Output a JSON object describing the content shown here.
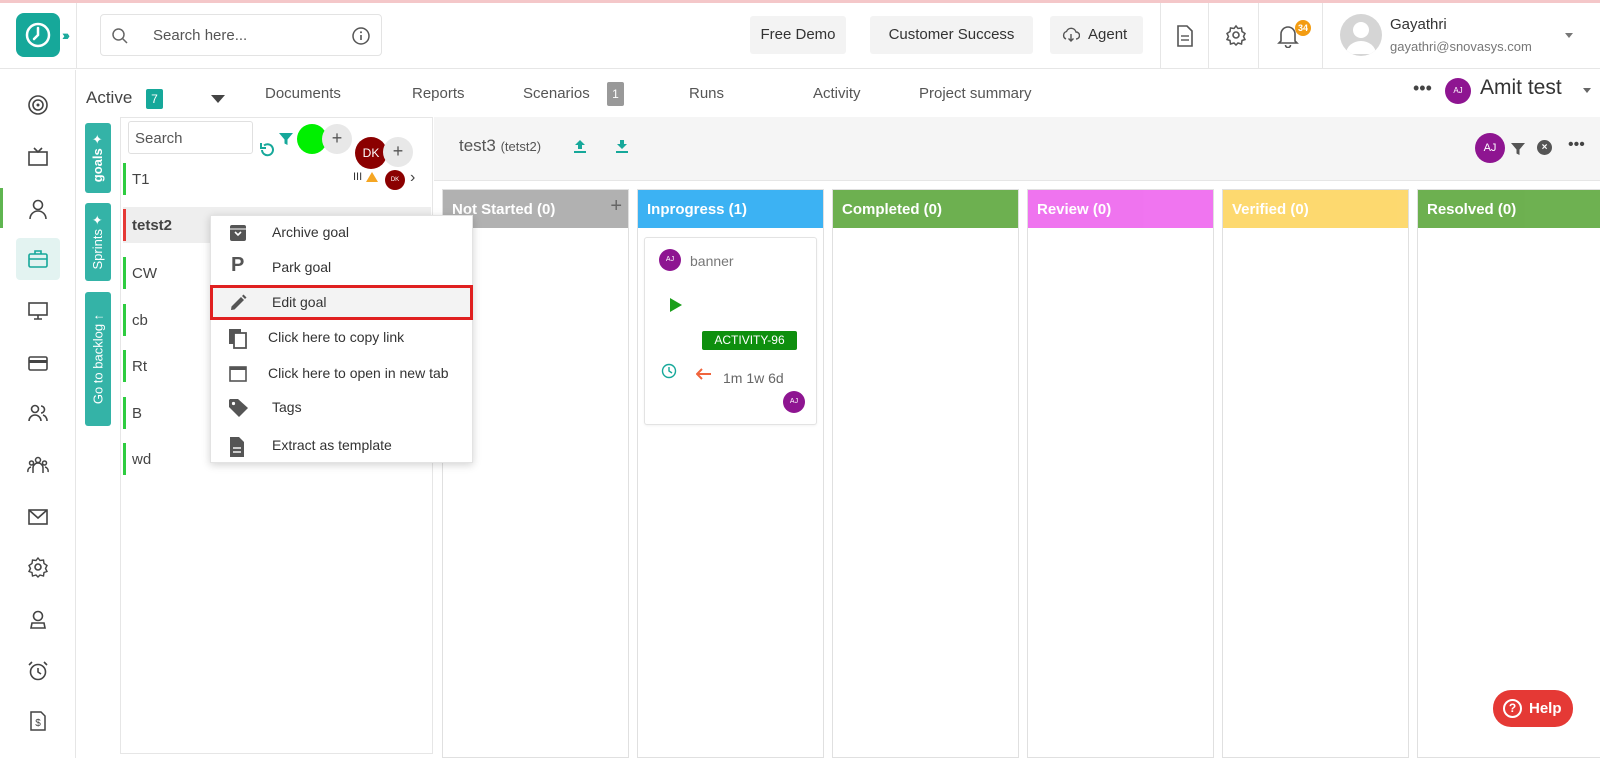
{
  "header": {
    "search_placeholder": "Search here...",
    "free_demo": "Free Demo",
    "customer_success": "Customer Success",
    "agent": "Agent",
    "notification_count": "34",
    "user_name": "Gayathri",
    "user_email": "gayathri@snovasys.com"
  },
  "tabs": {
    "active_label": "Active",
    "active_count": "7",
    "documents": "Documents",
    "reports": "Reports",
    "scenarios": "Scenarios",
    "scenarios_count": "1",
    "runs": "Runs",
    "activity": "Activity",
    "project_summary": "Project summary",
    "project_avatar": "AJ",
    "project_name": "Amit test"
  },
  "vertical_tabs": {
    "goals": "goals",
    "sprints": "Sprints",
    "backlog": "Go to backlog"
  },
  "goal_list": {
    "search_placeholder": "Search",
    "dk_initials": "DK",
    "t1_meta": "III",
    "goals": [
      "T1",
      "tetst2",
      "CW",
      "cb",
      "Rt",
      "B",
      "wd"
    ]
  },
  "board": {
    "title": "test3",
    "subtitle": "(tetst2)",
    "avatar": "AJ",
    "columns": [
      {
        "label": "Not Started (0)",
        "color": "#a9a9a9"
      },
      {
        "label": "Inprogress (1)",
        "color": "#27aaf2"
      },
      {
        "label": "Completed (0)",
        "color": "#5ea83e"
      },
      {
        "label": "Review (0)",
        "color": "#ee66ee"
      },
      {
        "label": "Verified (0)",
        "color": "#fdd560"
      },
      {
        "label": "Resolved (0)",
        "color": "#5ea83e"
      }
    ]
  },
  "card": {
    "avatar": "AJ",
    "title": "banner",
    "tag": "ACTIVITY-96",
    "time": "1m 1w 6d"
  },
  "context_menu": {
    "archive": "Archive goal",
    "park": "Park goal",
    "edit": "Edit goal",
    "copy_link": "Click here to copy link",
    "new_tab": "Click here to open in new tab",
    "tags": "Tags",
    "extract": "Extract as template"
  },
  "help": "Help"
}
